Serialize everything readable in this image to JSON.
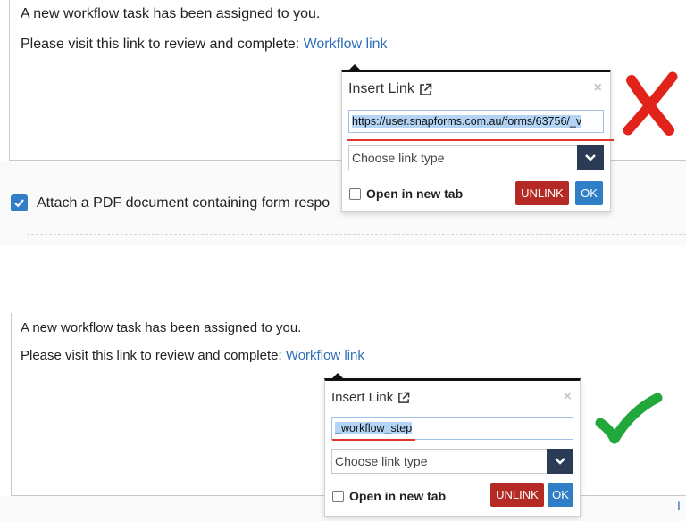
{
  "top": {
    "message_line1": "A new workflow task has been assigned to you.",
    "message_line2_prefix": "Please visit this link to review and complete:",
    "message_link": "Workflow link",
    "attach_label": "Attach a PDF document containing form respo",
    "popover": {
      "title": "Insert Link",
      "close": "×",
      "url_value": "https://user.snapforms.com.au/forms/63756/_v",
      "link_type_placeholder": "Choose link type",
      "open_new_tab": "Open in new tab",
      "unlink_label": "UNLINK",
      "ok_label": "OK"
    },
    "verdict_icon": "red-cross-icon",
    "verdict_color": "#e2231a"
  },
  "bottom": {
    "message_line1": "A new workflow task has been assigned to you.",
    "message_line2_prefix": "Please visit this link to review and complete:",
    "message_link": "Workflow link",
    "popover": {
      "title": "Insert Link",
      "close": "×",
      "url_value": "_workflow_step",
      "link_type_placeholder": "Choose link type",
      "open_new_tab": "Open in new tab",
      "unlink_label": "UNLINK",
      "ok_label": "OK"
    },
    "edge_text": "I",
    "verdict_icon": "green-check-icon",
    "verdict_color": "#22a83a"
  },
  "colors": {
    "link": "#2e6fb7",
    "unlink_button": "#b52a25",
    "ok_button": "#2f7ec6",
    "select_arrow": "#2b3b55",
    "underline_red": "#e2372e"
  }
}
